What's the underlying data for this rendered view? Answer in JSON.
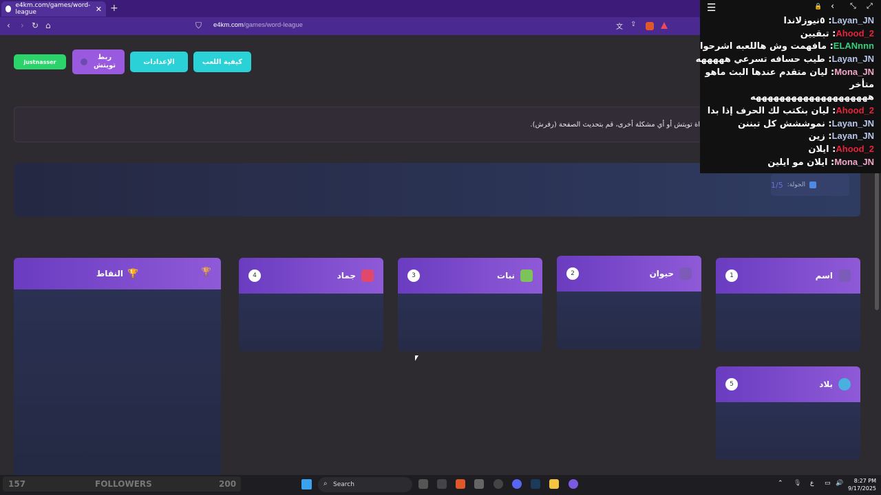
{
  "browser": {
    "tab_title": "e4km.com/games/word-league",
    "tab_close": "✕",
    "new_tab": "+",
    "url_host": "e4km.com",
    "url_path": "/games/word-league"
  },
  "toolbar": {
    "user_badge": "justnasser",
    "twitch_link": "ربط تويتش",
    "settings": "الإعدادات",
    "how_to_play": "كيفية اللعب"
  },
  "notice": "اة تويتش أو أي مشكلة أخرى، قم بتحديث الصفحة (رفرش).",
  "round": {
    "label": "الجولة:",
    "count": "1/5"
  },
  "categories": [
    {
      "title": "اسم",
      "num": "1",
      "icon": "person-icon"
    },
    {
      "title": "حيوان",
      "num": "2",
      "icon": "paw-icon"
    },
    {
      "title": "نبات",
      "num": "3",
      "icon": "leaf-icon"
    },
    {
      "title": "جماد",
      "num": "4",
      "icon": "robot-icon"
    },
    {
      "title": "بلاد",
      "num": "5",
      "icon": "globe-icon"
    }
  ],
  "points": {
    "title": "النقاط"
  },
  "chat": {
    "messages": [
      {
        "user": "Layan_JN",
        "color": "#b9c7ea",
        "text": "٥نيوزلاندا"
      },
      {
        "user": "Ahood_2",
        "color": "#e8223c",
        "text": "تبقيين"
      },
      {
        "user": "ELANnnn",
        "color": "#33d07a",
        "text": "مافهمت وش هاللعبه اشرحوا"
      },
      {
        "user": "Layan_JN",
        "color": "#b9c7ea",
        "text": "طيب حسافه تسرعي هههههه"
      },
      {
        "user": "Mona_JN",
        "color": "#f1a8c8",
        "text": "ليان متقدم عندها البث ماهو"
      },
      {
        "user": "",
        "color": "#ffffff",
        "text": "متأخر"
      },
      {
        "user": "",
        "color": "#ffffff",
        "text": "ههههههههههههههههههههه"
      },
      {
        "user": "Ahood_2",
        "color": "#e8223c",
        "text": "ليان بنكتب لك الحرف إذا بدا"
      },
      {
        "user": "Layan_JN",
        "color": "#b9c7ea",
        "text": "نموششش كل تبننن"
      },
      {
        "user": "Layan_JN",
        "color": "#b9c7ea",
        "text": "زين"
      },
      {
        "user": "Ahood_2",
        "color": "#e8223c",
        "text": "ايلان"
      },
      {
        "user": "Mona_JN",
        "color": "#f1a8c8",
        "text": "ايلان مو ايلين"
      }
    ]
  },
  "followers": {
    "current": "157",
    "label": "FOLLOWERS",
    "goal": "200"
  },
  "taskbar": {
    "search": "Search",
    "time": "8:27 PM",
    "date": "9/17/2025",
    "lang": "ع"
  },
  "colors": {
    "accent": "#8f5ad8",
    "teal": "#2ad1d6",
    "green": "#2bd36b"
  }
}
